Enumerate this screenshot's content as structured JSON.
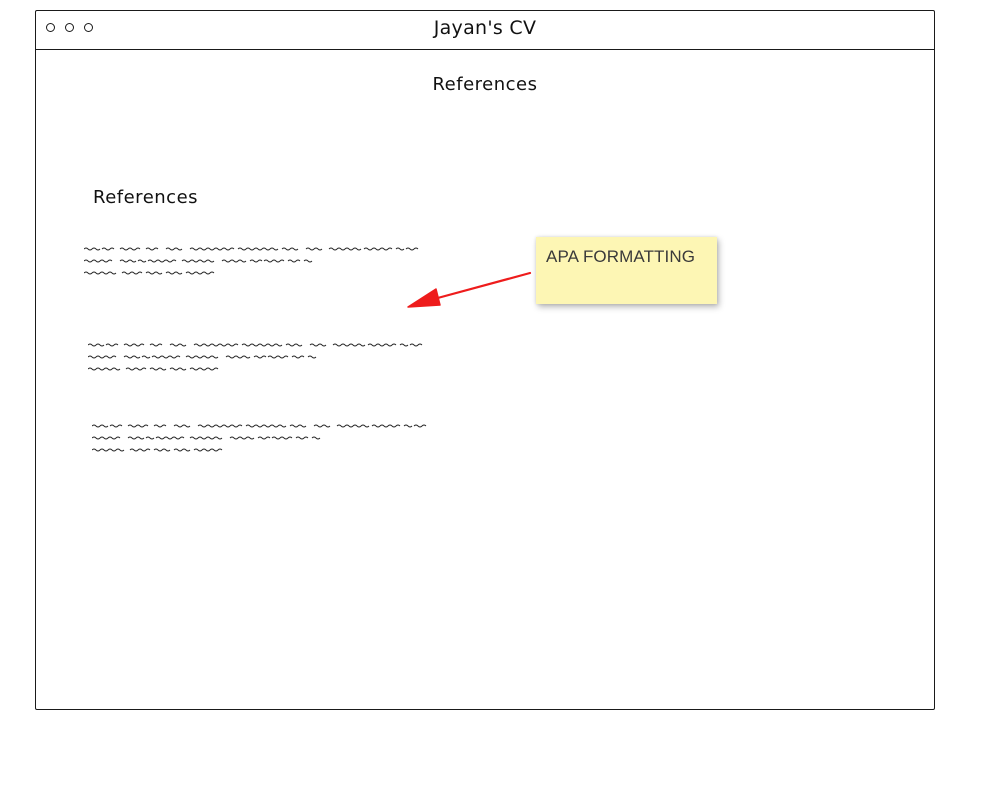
{
  "window": {
    "title": "Jayan's CV",
    "controls": [
      "close",
      "minimize",
      "maximize"
    ]
  },
  "page": {
    "heading": "References"
  },
  "section": {
    "heading": "References",
    "entries": [
      {
        "kind": "placeholder-text",
        "lines": 3
      },
      {
        "kind": "placeholder-text",
        "lines": 3
      },
      {
        "kind": "placeholder-text",
        "lines": 3
      }
    ]
  },
  "annotation": {
    "note": "APA FORMATTING",
    "note_color": "#fdf6b4",
    "arrow_color": "#ee1c1c"
  }
}
